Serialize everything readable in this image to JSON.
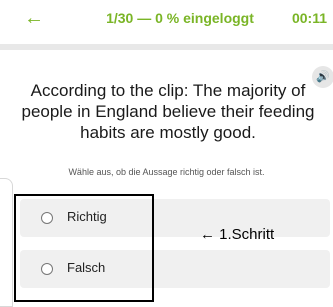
{
  "header": {
    "back_icon": "←",
    "progress": "1/30 — 0 % eingeloggt",
    "timer": "00:11"
  },
  "question": {
    "audio_icon": "🔊",
    "text": "According to the clip: The majority of people in England believe their feeding habits are mostly good."
  },
  "instruction": "Wähle aus, ob die Aussage richtig oder falsch ist.",
  "options": [
    {
      "label": "Richtig",
      "selected": false
    },
    {
      "label": "Falsch",
      "selected": false
    }
  ],
  "annotation": {
    "text": "← 1.Schritt"
  },
  "colors": {
    "accent": "#7ab526",
    "option_bg": "#f0f0f0",
    "annotation": "#000000"
  }
}
